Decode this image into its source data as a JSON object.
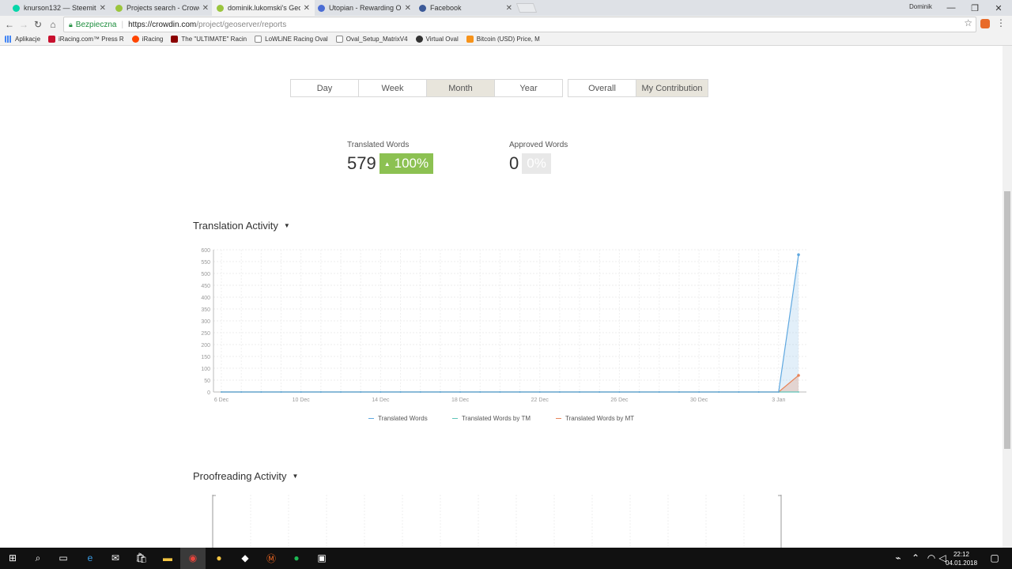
{
  "browser": {
    "tabs": [
      {
        "label": "knurson132 — Steemit",
        "color": "#06d6a9"
      },
      {
        "label": "Projects search - Crowdin",
        "color": "#9bc53d"
      },
      {
        "label": "dominik.lukomski's GeoServer",
        "color": "#9bc53d"
      },
      {
        "label": "Utopian - Rewarding Open Source",
        "color": "#4a6cd4"
      },
      {
        "label": "Facebook",
        "color": "#3b5998"
      }
    ],
    "user": "Dominik",
    "secure_label": "Bezpieczna",
    "url_host": "https://crowdin.com",
    "url_path": "/project/geoserver/reports",
    "bookmarks": [
      {
        "label": "Aplikacje",
        "color": "#4285f4"
      },
      {
        "label": "iRacing.com™ Press R",
        "color": "#c8102e"
      },
      {
        "label": "iRacing",
        "color": "#ff4500"
      },
      {
        "label": "The \"ULTIMATE\" Racin",
        "color": "#8b0000"
      },
      {
        "label": "LoWLiNE Racing Oval",
        "color": "#888888"
      },
      {
        "label": "Oval_Setup_MatrixV4",
        "color": "#888888"
      },
      {
        "label": "Virtual Oval",
        "color": "#333333"
      },
      {
        "label": "Bitcoin (USD) Price, M",
        "color": "#f7931a"
      }
    ]
  },
  "report": {
    "periods": [
      "Day",
      "Week",
      "Month",
      "Year"
    ],
    "active_period": "Month",
    "scopes": [
      "Overall",
      "My Contribution"
    ],
    "active_scope": "My Contribution",
    "translated": {
      "label": "Translated Words",
      "value": "579",
      "delta": "100%"
    },
    "approved": {
      "label": "Approved Words",
      "value": "0",
      "delta": "0%"
    },
    "translation_title": "Translation Activity",
    "proofreading_title": "Proofreading Activity"
  },
  "chart_data": {
    "type": "area",
    "x": [
      "6 Dec",
      "7 Dec",
      "8 Dec",
      "9 Dec",
      "10 Dec",
      "11 Dec",
      "12 Dec",
      "13 Dec",
      "14 Dec",
      "15 Dec",
      "16 Dec",
      "17 Dec",
      "18 Dec",
      "19 Dec",
      "20 Dec",
      "21 Dec",
      "22 Dec",
      "23 Dec",
      "24 Dec",
      "25 Dec",
      "26 Dec",
      "27 Dec",
      "28 Dec",
      "29 Dec",
      "30 Dec",
      "31 Dec",
      "1 Jan",
      "2 Jan",
      "3 Jan",
      "4 Jan"
    ],
    "x_tick_labels": [
      "6 Dec",
      "10 Dec",
      "14 Dec",
      "18 Dec",
      "22 Dec",
      "26 Dec",
      "30 Dec",
      "3 Jan"
    ],
    "y_ticks": [
      0,
      50,
      100,
      150,
      200,
      250,
      300,
      350,
      400,
      450,
      500,
      550,
      600
    ],
    "ylim": [
      0,
      600
    ],
    "series": [
      {
        "name": "Translated Words",
        "color": "#5fa8e0",
        "values": [
          0,
          0,
          0,
          0,
          0,
          0,
          0,
          0,
          0,
          0,
          0,
          0,
          0,
          0,
          0,
          0,
          0,
          0,
          0,
          0,
          0,
          0,
          0,
          0,
          0,
          0,
          0,
          0,
          0,
          579
        ]
      },
      {
        "name": "Translated Words by TM",
        "color": "#5ec4b8",
        "values": [
          0,
          0,
          0,
          0,
          0,
          0,
          0,
          0,
          0,
          0,
          0,
          0,
          0,
          0,
          0,
          0,
          0,
          0,
          0,
          0,
          0,
          0,
          0,
          0,
          0,
          0,
          0,
          0,
          0,
          0
        ]
      },
      {
        "name": "Translated Words by MT",
        "color": "#e8855a",
        "values": [
          0,
          0,
          0,
          0,
          0,
          0,
          0,
          0,
          0,
          0,
          0,
          0,
          0,
          0,
          0,
          0,
          0,
          0,
          0,
          0,
          0,
          0,
          0,
          0,
          0,
          0,
          0,
          0,
          0,
          70
        ]
      }
    ],
    "grid": true,
    "legend_position": "bottom-center"
  },
  "taskbar": {
    "time": "22:12",
    "date": "04.01.2018"
  }
}
